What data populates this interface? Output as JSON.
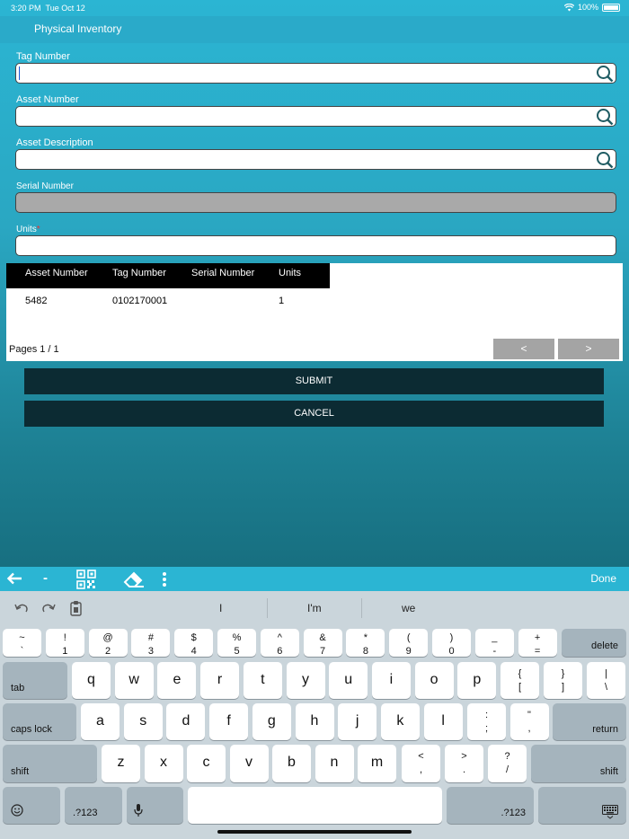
{
  "status": {
    "time": "3:20 PM",
    "date": "Tue Oct 12",
    "battery": "100%"
  },
  "app": {
    "title": "Physical Inventory"
  },
  "form": {
    "tag_label": "Tag Number",
    "asset_label": "Asset Number",
    "desc_label": "Asset Description",
    "serial_label": "Serial Number",
    "units_label": "Units",
    "units_required": "*"
  },
  "table": {
    "headers": [
      "Asset Number",
      "Tag Number",
      "Serial Number",
      "Units"
    ],
    "rows": [
      [
        "5482",
        "0102170001",
        "",
        "1"
      ]
    ],
    "pages": "Pages 1 / 1",
    "prev": "<",
    "next": ">"
  },
  "buttons": {
    "submit": "SUBMIT",
    "cancel": "CANCEL"
  },
  "kbtoolbar": {
    "minus": "-",
    "done": "Done"
  },
  "suggestions": [
    "I",
    "I'm",
    "we"
  ],
  "keys": {
    "row1": [
      [
        "~",
        "`"
      ],
      [
        "!",
        "1"
      ],
      [
        "@",
        "2"
      ],
      [
        "#",
        "3"
      ],
      [
        "$",
        "4"
      ],
      [
        "%",
        "5"
      ],
      [
        "^",
        "6"
      ],
      [
        "&",
        "7"
      ],
      [
        "*",
        "8"
      ],
      [
        "(",
        "9"
      ],
      [
        ")",
        "0"
      ],
      [
        "_",
        "-"
      ],
      [
        "+",
        "="
      ]
    ],
    "delete": "delete",
    "tab": "tab",
    "row2": [
      "q",
      "w",
      "e",
      "r",
      "t",
      "y",
      "u",
      "i",
      "o",
      "p"
    ],
    "row2_extra": [
      [
        "{",
        "["
      ],
      [
        "}",
        "]"
      ],
      [
        "|",
        "\\"
      ]
    ],
    "caps": "caps lock",
    "row3": [
      "a",
      "s",
      "d",
      "f",
      "g",
      "h",
      "j",
      "k",
      "l"
    ],
    "row3_extra": [
      [
        ":",
        ";"
      ],
      [
        "\"",
        ","
      ]
    ],
    "return": "return",
    "shift": "shift",
    "row4": [
      "z",
      "x",
      "c",
      "v",
      "b",
      "n",
      "m"
    ],
    "row4_extra": [
      [
        "<",
        ","
      ],
      [
        ">",
        "."
      ],
      [
        "?",
        "/"
      ]
    ],
    "num": ".?123"
  }
}
